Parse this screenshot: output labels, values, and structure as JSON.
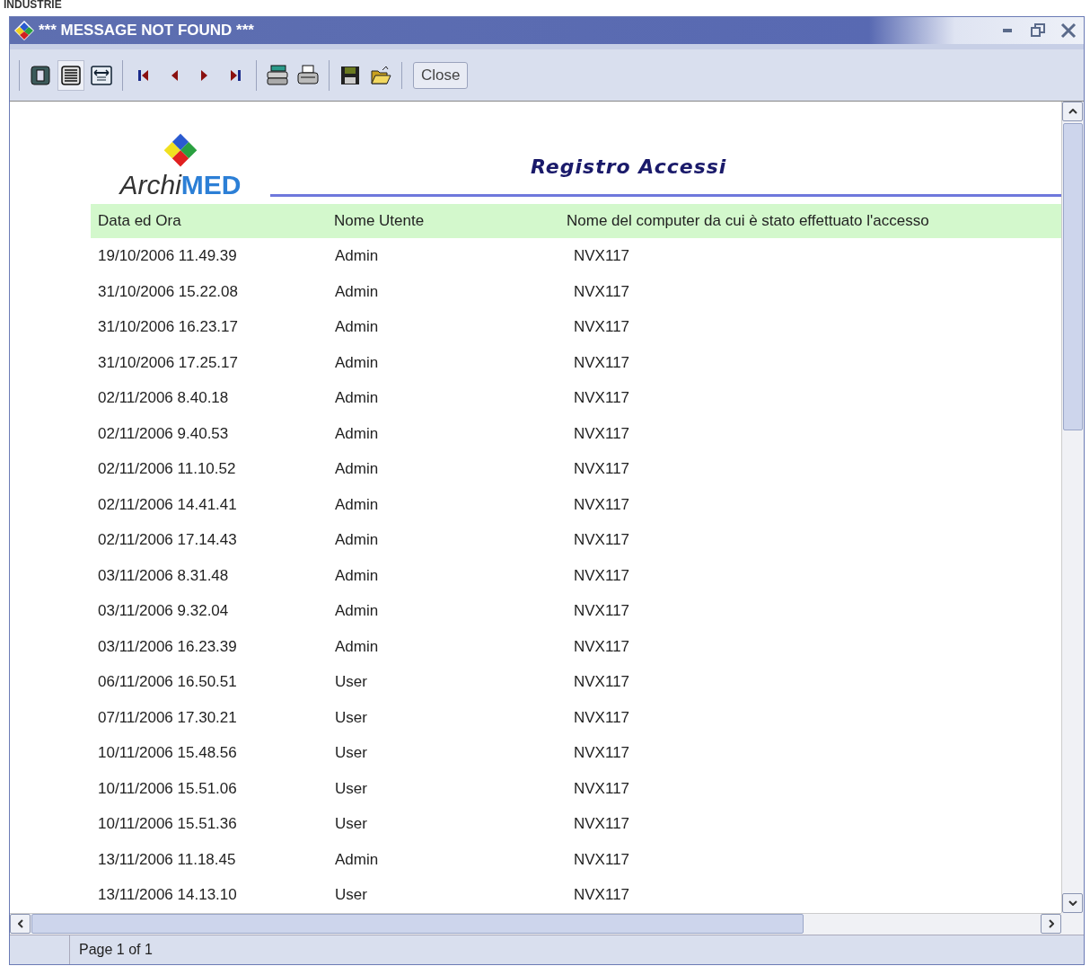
{
  "backdrop_label": "INDUSTRIE",
  "window": {
    "title": "*** MESSAGE NOT FOUND ***"
  },
  "toolbar": {
    "groups": [
      [
        {
          "kind": "single-page",
          "selected": false
        },
        {
          "kind": "list-page",
          "selected": true
        },
        {
          "kind": "fit-page",
          "selected": false
        }
      ],
      [
        {
          "kind": "first",
          "selected": false
        },
        {
          "kind": "prev",
          "selected": false
        },
        {
          "kind": "next",
          "selected": false
        },
        {
          "kind": "last",
          "selected": false
        }
      ],
      [
        {
          "kind": "print-setup",
          "selected": false
        },
        {
          "kind": "print",
          "selected": false
        }
      ],
      [
        {
          "kind": "save",
          "selected": false
        },
        {
          "kind": "open",
          "selected": false
        }
      ]
    ],
    "close_button": "Close"
  },
  "report": {
    "logo": {
      "prefix": "Archi",
      "suffix": "MED"
    },
    "title": "Registro Accessi",
    "columns": [
      "Data ed Ora",
      "Nome Utente",
      "Nome del computer da cui è stato effettuato l'accesso"
    ],
    "rows": [
      [
        "19/10/2006 11.49.39",
        "Admin",
        "NVX117"
      ],
      [
        "31/10/2006 15.22.08",
        "Admin",
        "NVX117"
      ],
      [
        "31/10/2006 16.23.17",
        "Admin",
        "NVX117"
      ],
      [
        "31/10/2006 17.25.17",
        "Admin",
        "NVX117"
      ],
      [
        "02/11/2006 8.40.18",
        "Admin",
        "NVX117"
      ],
      [
        "02/11/2006 9.40.53",
        "Admin",
        "NVX117"
      ],
      [
        "02/11/2006 11.10.52",
        "Admin",
        "NVX117"
      ],
      [
        "02/11/2006 14.41.41",
        "Admin",
        "NVX117"
      ],
      [
        "02/11/2006 17.14.43",
        "Admin",
        "NVX117"
      ],
      [
        "03/11/2006 8.31.48",
        "Admin",
        "NVX117"
      ],
      [
        "03/11/2006 9.32.04",
        "Admin",
        "NVX117"
      ],
      [
        "03/11/2006 16.23.39",
        "Admin",
        "NVX117"
      ],
      [
        "06/11/2006 16.50.51",
        "User",
        "NVX117"
      ],
      [
        "07/11/2006 17.30.21",
        "User",
        "NVX117"
      ],
      [
        "10/11/2006 15.48.56",
        "User",
        "NVX117"
      ],
      [
        "10/11/2006 15.51.06",
        "User",
        "NVX117"
      ],
      [
        "10/11/2006 15.51.36",
        "User",
        "NVX117"
      ],
      [
        "13/11/2006 11.18.45",
        "Admin",
        "NVX117"
      ],
      [
        "13/11/2006 14.13.10",
        "User",
        "NVX117"
      ]
    ]
  },
  "status_bar": {
    "page": "Page 1 of 1"
  }
}
